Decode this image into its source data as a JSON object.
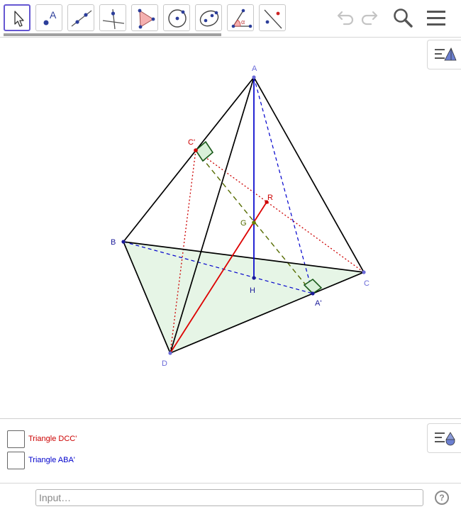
{
  "toolbar": {
    "tools": [
      {
        "id": "move",
        "icon": "arrow-cursor-icon",
        "selected": true
      },
      {
        "id": "point",
        "icon": "point-icon",
        "glyph": "A"
      },
      {
        "id": "line",
        "icon": "line-through-two-points-icon"
      },
      {
        "id": "perpendicular",
        "icon": "perpendicular-line-icon"
      },
      {
        "id": "polygon",
        "icon": "polygon-icon"
      },
      {
        "id": "circle",
        "icon": "circle-center-point-icon"
      },
      {
        "id": "conic",
        "icon": "ellipse-icon"
      },
      {
        "id": "angle",
        "icon": "angle-icon",
        "glyph": "α"
      },
      {
        "id": "reflect",
        "icon": "reflect-about-line-icon"
      }
    ],
    "undo_icon": "undo-icon",
    "redo_icon": "redo-icon",
    "search_icon": "search-icon",
    "menu_icon": "hamburger-menu-icon"
  },
  "graphics": {
    "points": {
      "A": {
        "label": "A",
        "color": "#3a3ad0"
      },
      "B": {
        "label": "B",
        "color": "#1a1a9a"
      },
      "C": {
        "label": "C",
        "color": "#3a3ad0"
      },
      "D": {
        "label": "D",
        "color": "#3a3ad0"
      },
      "C1": {
        "label": "C'",
        "color": "#cc0000"
      },
      "R": {
        "label": "R",
        "color": "#cc0000"
      },
      "G": {
        "label": "G",
        "color": "#556b00"
      },
      "H": {
        "label": "H",
        "color": "#1a1a9a"
      },
      "A1": {
        "label": "A'",
        "color": "#1a1a9a"
      }
    },
    "style_bar_icon": "graphics-style-bar-icon"
  },
  "algebra": {
    "items": [
      {
        "label": "Triangle DCC'",
        "color": "#cc0000",
        "checked": false
      },
      {
        "label": "Triangle ABA'",
        "color": "#0000cc",
        "checked": false
      }
    ],
    "style_bar_icon": "algebra-style-bar-icon"
  },
  "input_bar": {
    "placeholder": "Input…",
    "help_label": "?"
  }
}
